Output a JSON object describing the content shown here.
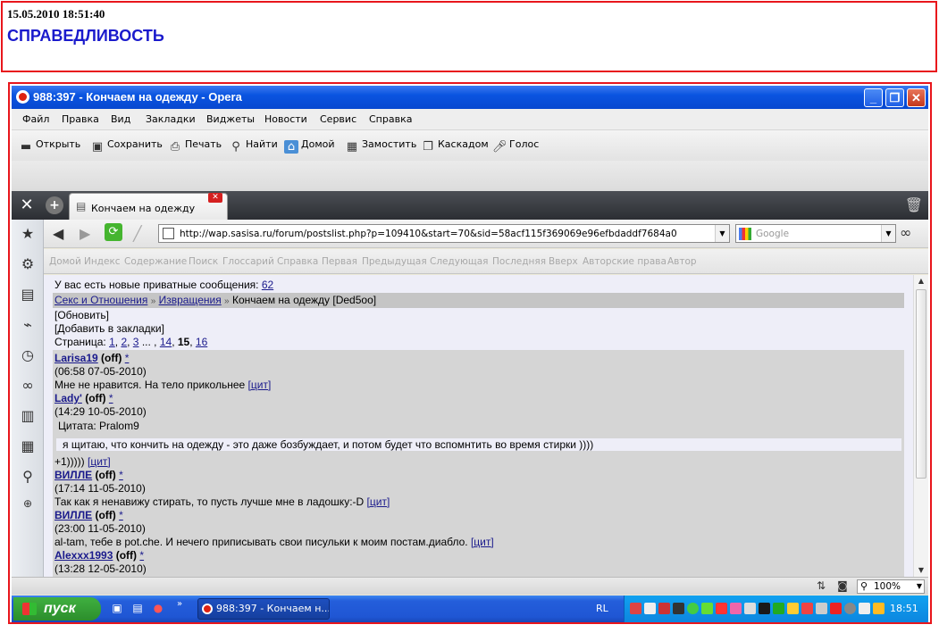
{
  "note": {
    "timestamp": "15.05.2010 18:51:40",
    "heading": "СПРАВЕДЛИВОСТЬ"
  },
  "window": {
    "title": "988:397 - Кончаем на одежду - Opera"
  },
  "menu": [
    "Файл",
    "Правка",
    "Вид",
    "Закладки",
    "Виджеты",
    "Новости",
    "Сервис",
    "Справка"
  ],
  "toolbar": {
    "open": "Открыть",
    "save": "Сохранить",
    "print": "Печать",
    "find": "Найти",
    "home": "Домой",
    "tile": "Замостить",
    "cascade": "Каскадом",
    "voice": "Голос"
  },
  "tab": {
    "label": "Кончаем на одежду"
  },
  "address": {
    "url": "http://wap.sasisa.ru/forum/postslist.php?p=109410&start=70&sid=58acf115f369069e96efbdaddf7684a0",
    "search_placeholder": "Google"
  },
  "navlinks": [
    "Домой",
    "Индекс",
    "Содержание",
    "Поиск",
    "Глоссарий",
    "Справка",
    "Первая",
    "Предыдущая",
    "Следующая",
    "Последняя",
    "Вверх",
    "Авторские права",
    "Автор"
  ],
  "page": {
    "private_msg": "У вас есть новые приватные сообщения:",
    "private_count": "62",
    "crumb1": "Секс и Отношения",
    "crumb_sep": "»",
    "crumb2": "Извращения",
    "crumb3": "Кончаем на одежду [Ded5oo]",
    "refresh": "[Обновить]",
    "bookmark": "[Добавить в закладки]",
    "pages_label": "Страница:",
    "pages": [
      "1",
      "2",
      "3",
      "14",
      "15",
      "16"
    ],
    "cite": "[цит]",
    "star": "*",
    "off": "(off)",
    "posts": [
      {
        "nick": "Larisa19",
        "time": "(06:58 07-05-2010)",
        "text": "Мне не нравится. На тело прикольнее"
      },
      {
        "nick": "Lady'",
        "time": "(14:29 10-05-2010)",
        "quote_label": "Цитата: Pralom9",
        "quote": "я щитаю, что кончить на одежду - это даже бозбуждает, и потом будет что вспомнтить во время стирки ))))",
        "text": "+1)))))"
      },
      {
        "nick": "ВИЛЛЕ",
        "time": "(17:14 11-05-2010)",
        "text": "Так как я ненавижу стирать, то пусть лучше мне в ладошку:-D"
      },
      {
        "nick": "ВИЛЛЕ",
        "time": "(23:00 11-05-2010)",
        "text": "al-tam, тебе в pot.che. И нечего приписывать свои писульки к моим постам.диабло."
      },
      {
        "nick": "Alexxx1993",
        "time": "(13:28 12-05-2010)",
        "text": ""
      }
    ]
  },
  "status": {
    "zoom": "100%"
  },
  "taskbar": {
    "start": "пуск",
    "task": "988:397 - Кончаем н...",
    "lang": "RL",
    "clock": "18:51"
  },
  "colors": {
    "frame_red": "#e8161c",
    "heading_blue": "#1a1acc",
    "link_blue": "#1a1a8c",
    "xp_blue": "#245edb",
    "start_green": "#3fb040"
  }
}
